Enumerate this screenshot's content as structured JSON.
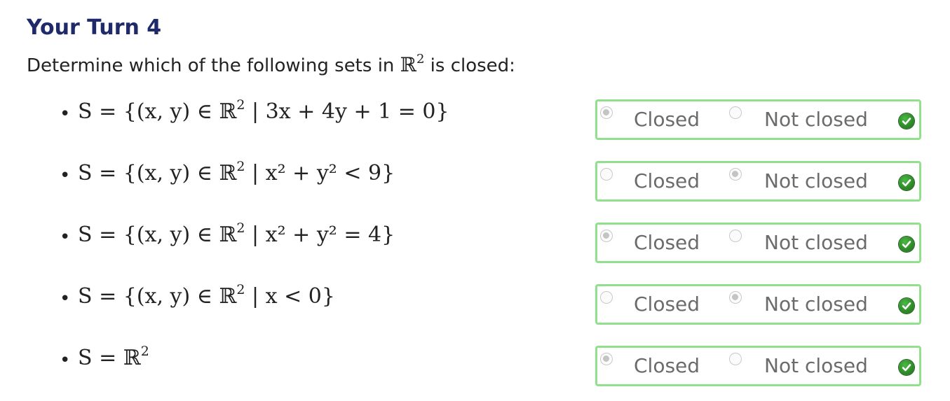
{
  "title": "Your Turn 4",
  "prompt": {
    "before": "Determine which of the following sets in ",
    "bb": "ℝ",
    "sup": "2",
    "after": " is closed:"
  },
  "items": [
    {
      "math_before": "S = {(x, y) ∈ ℝ",
      "math_sup": "2",
      "math_after": " | 3x + 4y + 1 = 0}",
      "options": [
        "Closed",
        "Not closed"
      ],
      "selected": "Closed",
      "correct": true
    },
    {
      "math_before": "S = {(x, y) ∈ ℝ",
      "math_sup": "2",
      "math_after": " | x² + y² < 9}",
      "options": [
        "Closed",
        "Not closed"
      ],
      "selected": "Not closed",
      "correct": true
    },
    {
      "math_before": "S = {(x, y) ∈ ℝ",
      "math_sup": "2",
      "math_after": " | x² + y² = 4}",
      "options": [
        "Closed",
        "Not closed"
      ],
      "selected": "Closed",
      "correct": true
    },
    {
      "math_before": "S = {(x, y) ∈ ℝ",
      "math_sup": "2",
      "math_after": " | x < 0}",
      "options": [
        "Closed",
        "Not closed"
      ],
      "selected": "Not closed",
      "correct": true
    },
    {
      "math_before": "S = ℝ",
      "math_sup": "2",
      "math_after": "",
      "options": [
        "Closed",
        "Not closed"
      ],
      "selected": "Closed",
      "correct": true
    }
  ],
  "colors": {
    "title": "#1f2a6b",
    "box_border": "#90e08d",
    "check": "#2d8a27"
  },
  "icons": {
    "correct": "check-circle-icon"
  }
}
